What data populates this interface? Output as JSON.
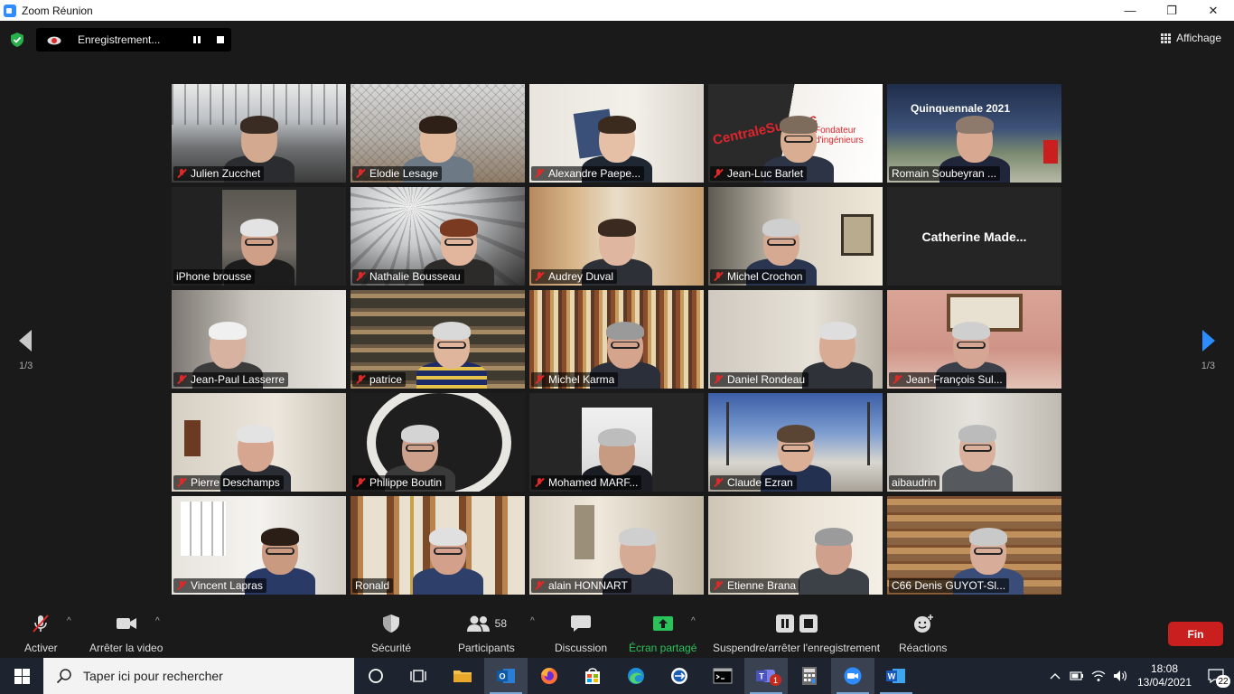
{
  "window": {
    "title": "Zoom Réunion",
    "minimize": "—",
    "restore": "❐",
    "close": "✕"
  },
  "topbar": {
    "recording_label": "Enregistrement...",
    "view_label": "Affichage"
  },
  "gallery": {
    "page_left": "1/3",
    "page_right": "1/3",
    "tiles": [
      {
        "name": "Julien Zucchet",
        "muted": true
      },
      {
        "name": "Elodie Lesage",
        "muted": true
      },
      {
        "name": "Alexandre Paepe...",
        "muted": true
      },
      {
        "name": "Jean-Luc Barlet",
        "muted": true
      },
      {
        "name": "Romain Soubeyran ...",
        "muted": false
      },
      {
        "name": "iPhone brousse",
        "muted": false,
        "active": true
      },
      {
        "name": "Nathalie Bousseau",
        "muted": true
      },
      {
        "name": "Audrey Duval",
        "muted": true
      },
      {
        "name": "Michel Crochon",
        "muted": true
      },
      {
        "name": "Catherine  Made...",
        "muted": false,
        "no_video": true
      },
      {
        "name": "Jean-Paul Lasserre",
        "muted": true
      },
      {
        "name": "patrice",
        "muted": true
      },
      {
        "name": "Michel Karma",
        "muted": true
      },
      {
        "name": "Daniel Rondeau",
        "muted": true
      },
      {
        "name": "Jean-François Sul...",
        "muted": true
      },
      {
        "name": "Pierre Deschamps",
        "muted": true
      },
      {
        "name": "Philippe Boutin",
        "muted": true
      },
      {
        "name": "Mohamed MARF...",
        "muted": true
      },
      {
        "name": "Claude Ezran",
        "muted": true
      },
      {
        "name": "aibaudrin",
        "muted": false
      },
      {
        "name": "Vincent Lapras",
        "muted": true
      },
      {
        "name": "Ronald",
        "muted": false
      },
      {
        "name": "alain HONNART",
        "muted": true
      },
      {
        "name": "Etienne Brana",
        "muted": true
      },
      {
        "name": "C66 Denis GUYOT-Sl...",
        "muted": false
      }
    ],
    "tile_overlays": {
      "tile3_text": "CentraleSupélec",
      "tile3_sub": "Fondateur d'ingénieurs",
      "tile4_text": "Quinquennale 2021"
    }
  },
  "toolbar": {
    "mute_label": "Activer",
    "video_label": "Arrêter la video",
    "security_label": "Sécurité",
    "participants_label": "Participants",
    "participants_count": "58",
    "chat_label": "Discussion",
    "share_label": "Écran partagé",
    "record_label": "Suspendre/arrêter l'enregistrement",
    "reactions_label": "Réactions",
    "end_label": "Fin"
  },
  "taskbar": {
    "search_placeholder": "Taper ici pour rechercher",
    "time": "18:08",
    "date": "13/04/2021",
    "notifications": "22",
    "teams_badge": "1"
  },
  "colors": {
    "mute_red": "#e02828",
    "active_border": "#d9e36b",
    "share_green": "#29c35a",
    "end_red": "#c91f1f",
    "arrow_blue": "#2d8cff"
  }
}
